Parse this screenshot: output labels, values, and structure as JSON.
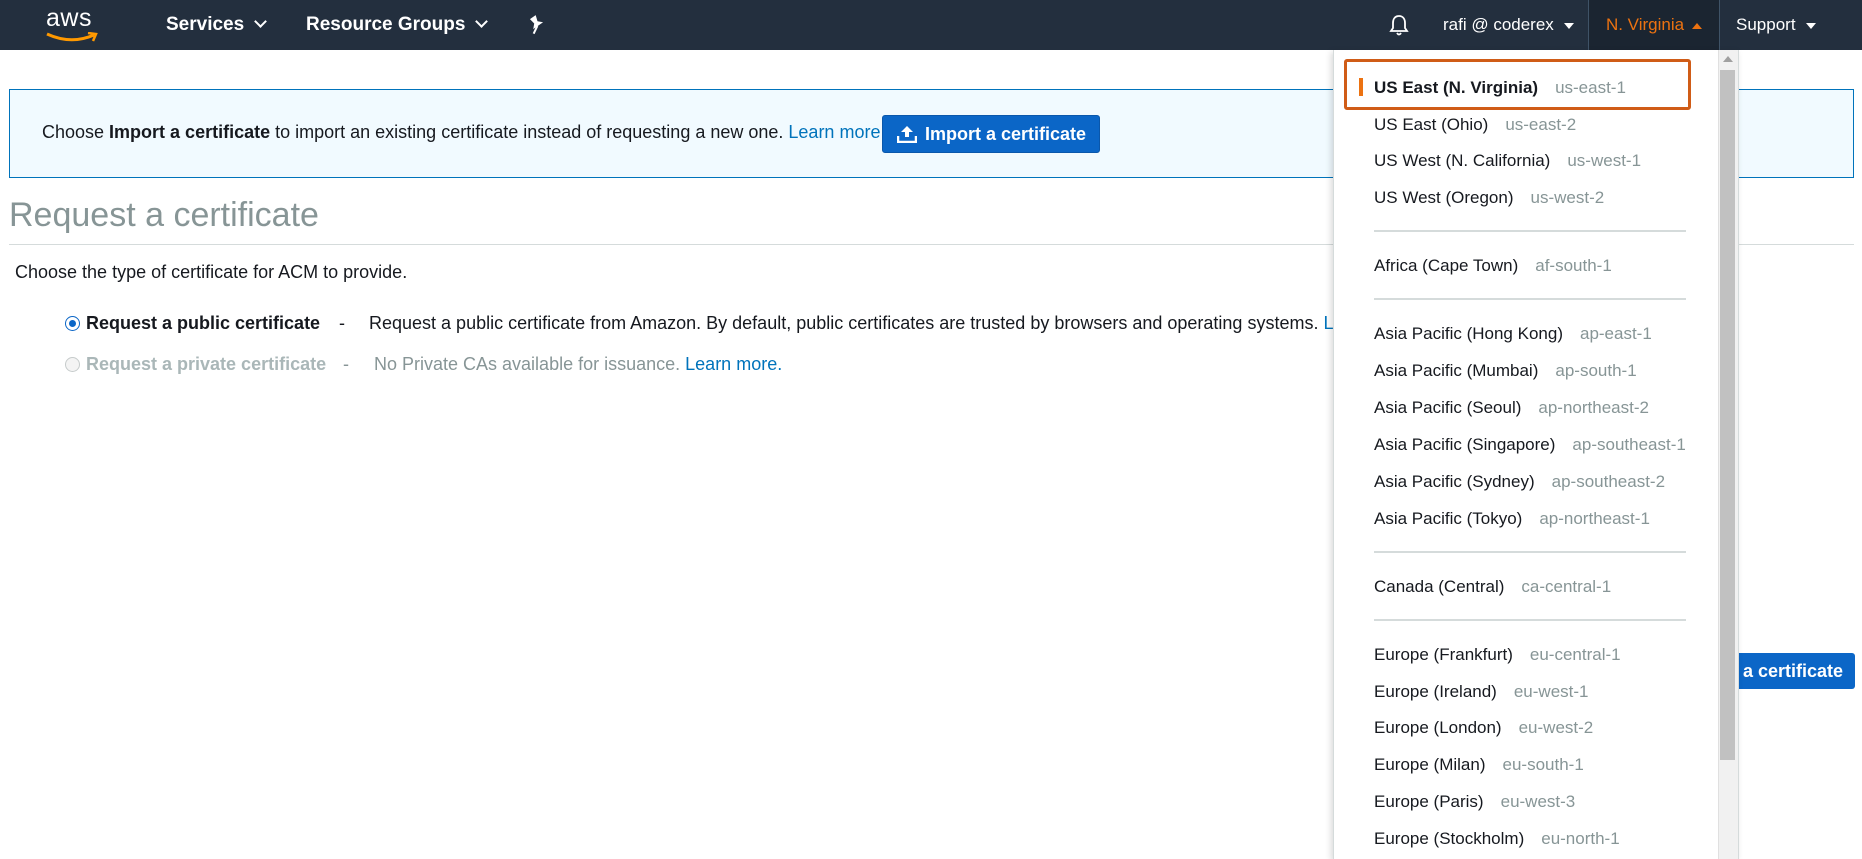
{
  "nav": {
    "logo": "aws",
    "services": "Services",
    "resource_groups": "Resource Groups",
    "user": "rafi @ coderex",
    "region": "N. Virginia",
    "support": "Support"
  },
  "banner": {
    "prefix": "Choose ",
    "bold": "Import a certificate",
    "suffix": " to import an existing certificate instead of requesting a new one. ",
    "learn_more": "Learn more.",
    "button": "Import a certificate"
  },
  "page": {
    "title": "Request a certificate",
    "subtitle": "Choose the type of certificate for ACM to provide."
  },
  "options": {
    "public_label": "Request a public certificate",
    "public_dash": "-",
    "public_desc": "Request a public certificate from Amazon. By default, public certificates are trusted by browsers and operating systems.",
    "public_link": "Lear",
    "private_label": "Request a private certificate",
    "private_dash": "-",
    "private_desc": "No Private CAs available for issuance.",
    "private_link": "Learn more."
  },
  "request_button": "a certificate",
  "regions": [
    {
      "name": "US East (N. Virginia)",
      "code": "us-east-1",
      "selected": true
    },
    {
      "name": "US East (Ohio)",
      "code": "us-east-2"
    },
    {
      "name": "US West (N. California)",
      "code": "us-west-1"
    },
    {
      "name": "US West (Oregon)",
      "code": "us-west-2"
    },
    {
      "name": "Africa (Cape Town)",
      "code": "af-south-1"
    },
    {
      "name": "Asia Pacific (Hong Kong)",
      "code": "ap-east-1"
    },
    {
      "name": "Asia Pacific (Mumbai)",
      "code": "ap-south-1"
    },
    {
      "name": "Asia Pacific (Seoul)",
      "code": "ap-northeast-2"
    },
    {
      "name": "Asia Pacific (Singapore)",
      "code": "ap-southeast-1"
    },
    {
      "name": "Asia Pacific (Sydney)",
      "code": "ap-southeast-2"
    },
    {
      "name": "Asia Pacific (Tokyo)",
      "code": "ap-northeast-1"
    },
    {
      "name": "Canada (Central)",
      "code": "ca-central-1"
    },
    {
      "name": "Europe (Frankfurt)",
      "code": "eu-central-1"
    },
    {
      "name": "Europe (Ireland)",
      "code": "eu-west-1"
    },
    {
      "name": "Europe (London)",
      "code": "eu-west-2"
    },
    {
      "name": "Europe (Milan)",
      "code": "eu-south-1"
    },
    {
      "name": "Europe (Paris)",
      "code": "eu-west-3"
    },
    {
      "name": "Europe (Stockholm)",
      "code": "eu-north-1"
    }
  ],
  "colors": {
    "nav_bg": "#232f3e",
    "accent_orange": "#ec7211",
    "link_blue": "#0073bb",
    "button_blue": "#0b66c7"
  }
}
